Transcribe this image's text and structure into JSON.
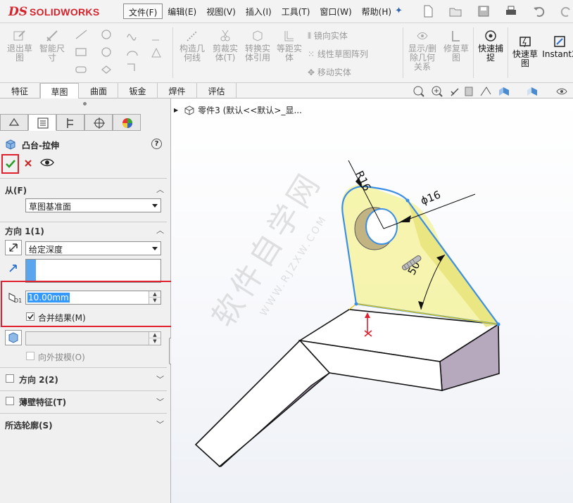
{
  "app": {
    "brand": "SOLIDWORKS",
    "brand_mark": "DS"
  },
  "menu": [
    "文件(F)",
    "编辑(E)",
    "视图(V)",
    "插入(I)",
    "工具(T)",
    "窗口(W)",
    "帮助(H)"
  ],
  "ribbon": {
    "exit_sketch": "退出草图",
    "smart_dimension": "智能尺寸",
    "construction_geometry": "构造几何线",
    "trim_entities": "剪裁实体(T)",
    "convert_entities": "转换实体引用",
    "offset_entities": "等距实体",
    "mirror_entities": "镜向实体",
    "linear_pattern": "线性草图阵列",
    "move_entities": "移动实体",
    "show_hide_relations": "显示/删除几何关系",
    "repair_sketch": "修复草图",
    "quick_snaps": "快速捕捉",
    "rapid_sketch": "快速草图",
    "instant2d": "Instant2"
  },
  "tabs": [
    "特征",
    "草图",
    "曲面",
    "钣金",
    "焊件",
    "评估"
  ],
  "active_tab": "草图",
  "tree_path": "零件3 (默认<<默认>_显...",
  "panel": {
    "title": "凸台-拉伸",
    "help": "?",
    "from_label": "从(F)",
    "from_value": "草图基准面",
    "dir1_label": "方向 1(1)",
    "dir1_end": "给定深度",
    "depth_value": "10.00mm",
    "merge_result": "合并结果(M)",
    "draft_outward": "向外拔模(O)",
    "dir2_label": "方向 2(2)",
    "thin_label": "薄壁特征(T)",
    "selected_contours": "所选轮廓(S)"
  },
  "dims": {
    "radius": "R16",
    "diameter": "ϕ16",
    "angle": "50"
  },
  "watermark": {
    "main": "软件自学网",
    "sub": "WWW.RJZXW.COM"
  },
  "colors": {
    "accent": "#d5232b",
    "selection_yellow": "#f3f07a",
    "highlight_red": "#e0202e",
    "sketch_blue": "#3d8fe5"
  }
}
